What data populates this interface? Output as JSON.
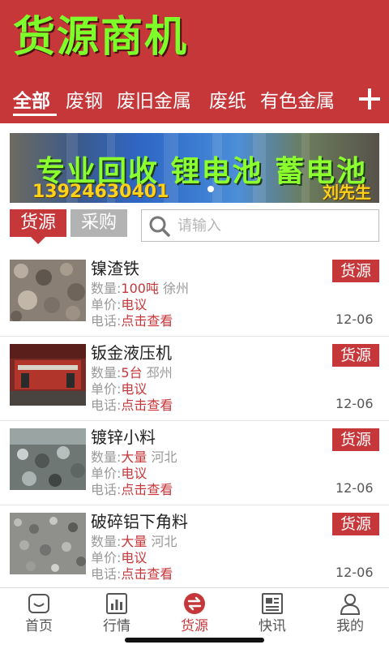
{
  "app": {
    "title": "货源商机"
  },
  "categories": [
    "全部",
    "废钢",
    "废旧金属",
    "废纸",
    "有色金属"
  ],
  "banner": {
    "headline": "专业回收 锂电池 蓄电池",
    "phone": "13924630401",
    "name": "刘先生"
  },
  "segments": {
    "supply": "货源",
    "demand": "采购"
  },
  "search": {
    "placeholder": "请输入"
  },
  "labels": {
    "qty": "数量:",
    "price": "单价:",
    "phone": "电话:"
  },
  "items": [
    {
      "name": "镍渣铁",
      "badge": "货源",
      "qty": "100吨",
      "location": "徐州",
      "price": "电议",
      "phone": "点击查看",
      "date": "12-06"
    },
    {
      "name": "钣金液压机",
      "badge": "货源",
      "qty": "5台",
      "location": "邳州",
      "price": "电议",
      "phone": "点击查看",
      "date": "12-06"
    },
    {
      "name": "镀锌小料",
      "badge": "货源",
      "qty": "大量",
      "location": "河北",
      "price": "电议",
      "phone": "点击查看",
      "date": "12-06"
    },
    {
      "name": "破碎铝下角料",
      "badge": "货源",
      "qty": "大量",
      "location": "河北",
      "price": "电议",
      "phone": "点击查看",
      "date": "12-06"
    }
  ],
  "tabbar": [
    {
      "label": "首页",
      "icon": "home-icon"
    },
    {
      "label": "行情",
      "icon": "chart-icon"
    },
    {
      "label": "货源",
      "icon": "exchange-icon"
    },
    {
      "label": "快讯",
      "icon": "news-icon"
    },
    {
      "label": "我的",
      "icon": "user-icon"
    }
  ],
  "colors": {
    "brand": "#c6373a",
    "title": "#7dff2a",
    "muted": "#b3b3b3"
  }
}
